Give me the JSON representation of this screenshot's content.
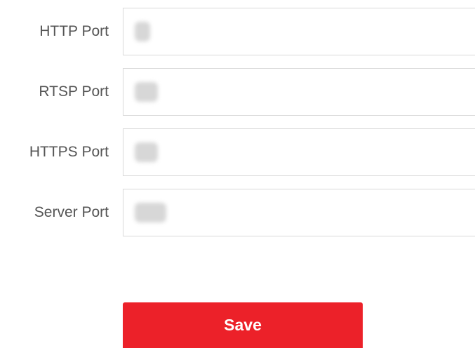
{
  "form": {
    "fields": [
      {
        "label": "HTTP Port",
        "value": "80"
      },
      {
        "label": "RTSP Port",
        "value": "554"
      },
      {
        "label": "HTTPS Port",
        "value": "443"
      },
      {
        "label": "Server Port",
        "value": "8000"
      }
    ]
  },
  "actions": {
    "save_label": "Save",
    "save_color": "#ec2129"
  }
}
